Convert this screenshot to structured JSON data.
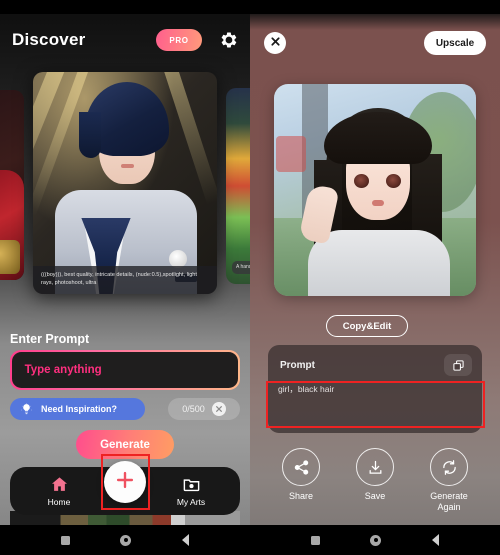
{
  "left": {
    "header": {
      "title": "Discover",
      "pro_label": "PRO",
      "settings_icon": "gear-icon"
    },
    "carousel": {
      "main_card_caption": "(((boy))), best quality, intricate details, (nude:0.5),spotlight, light rays, photoshoot, ultra",
      "right_card_caption": "A hand… greenh…"
    },
    "prompt": {
      "section_label": "Enter Prompt",
      "input_placeholder": "Type anything",
      "input_value": "",
      "inspiration_label": "Need Inspiration?",
      "inspiration_icon": "lightbulb-icon",
      "counter": "0/500",
      "clear_icon": "close-icon",
      "generate_label": "Generate"
    },
    "bottom_nav": {
      "items": [
        {
          "label": "Home",
          "icon": "home-icon"
        },
        {
          "label": "My Arts",
          "icon": "folder-photo-icon"
        }
      ],
      "fab_icon": "plus-icon"
    },
    "system_nav": {
      "recents_icon": "square-icon",
      "home_icon": "circle-icon",
      "back_icon": "chevron-left-icon"
    }
  },
  "right": {
    "header": {
      "close_icon": "close-icon",
      "upscale_label": "Upscale"
    },
    "result": {
      "image_alt": "anime girl with long black hair"
    },
    "copy_edit_label": "Copy&Edit",
    "prompt_card": {
      "label": "Prompt",
      "copy_icon": "copy-icon",
      "value": "girl，black hair"
    },
    "actions": [
      {
        "label": "Share",
        "icon": "share-icon"
      },
      {
        "label": "Save",
        "icon": "download-icon"
      },
      {
        "label": "Generate Again",
        "icon": "refresh-icon"
      }
    ],
    "system_nav": {
      "recents_icon": "square-icon",
      "home_icon": "circle-icon",
      "back_icon": "chevron-left-icon"
    }
  },
  "colors": {
    "accent_pink": "#ff3d8b",
    "accent_orange": "#ff9d63",
    "inspiration_blue": "#5577dd",
    "right_panel_bg": "#7b514e",
    "highlight_red": "#ee2222"
  }
}
